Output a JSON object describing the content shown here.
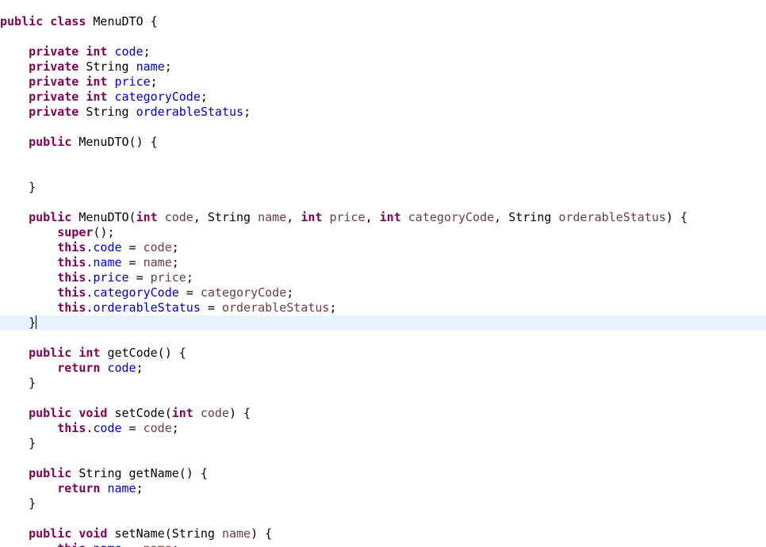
{
  "editor": {
    "current_line": 20,
    "colors": {
      "keyword": "#7f0055",
      "field": "#0000c0",
      "parameter": "#6a3e3e",
      "plain": "#000000",
      "current_line_highlight": "#e8f2fe"
    },
    "lines": [
      [
        {
          "t": "public",
          "c": "kw"
        },
        {
          "t": " "
        },
        {
          "t": "class",
          "c": "kw"
        },
        {
          "t": " MenuDTO {"
        }
      ],
      [],
      [
        {
          "t": "    "
        },
        {
          "t": "private",
          "c": "kw"
        },
        {
          "t": " "
        },
        {
          "t": "int",
          "c": "kw"
        },
        {
          "t": " "
        },
        {
          "t": "code",
          "c": "fld"
        },
        {
          "t": ";"
        }
      ],
      [
        {
          "t": "    "
        },
        {
          "t": "private",
          "c": "kw"
        },
        {
          "t": " String "
        },
        {
          "t": "name",
          "c": "fld"
        },
        {
          "t": ";"
        }
      ],
      [
        {
          "t": "    "
        },
        {
          "t": "private",
          "c": "kw"
        },
        {
          "t": " "
        },
        {
          "t": "int",
          "c": "kw"
        },
        {
          "t": " "
        },
        {
          "t": "price",
          "c": "fld"
        },
        {
          "t": ";"
        }
      ],
      [
        {
          "t": "    "
        },
        {
          "t": "private",
          "c": "kw"
        },
        {
          "t": " "
        },
        {
          "t": "int",
          "c": "kw"
        },
        {
          "t": " "
        },
        {
          "t": "categoryCode",
          "c": "fld"
        },
        {
          "t": ";"
        }
      ],
      [
        {
          "t": "    "
        },
        {
          "t": "private",
          "c": "kw"
        },
        {
          "t": " String "
        },
        {
          "t": "orderableStatus",
          "c": "fld"
        },
        {
          "t": ";"
        }
      ],
      [],
      [
        {
          "t": "    "
        },
        {
          "t": "public",
          "c": "kw"
        },
        {
          "t": " MenuDTO() {"
        }
      ],
      [],
      [],
      [
        {
          "t": "    }"
        }
      ],
      [],
      [
        {
          "t": "    "
        },
        {
          "t": "public",
          "c": "kw"
        },
        {
          "t": " MenuDTO("
        },
        {
          "t": "int",
          "c": "kw"
        },
        {
          "t": " "
        },
        {
          "t": "code",
          "c": "prm"
        },
        {
          "t": ", String "
        },
        {
          "t": "name",
          "c": "prm"
        },
        {
          "t": ", "
        },
        {
          "t": "int",
          "c": "kw"
        },
        {
          "t": " "
        },
        {
          "t": "price",
          "c": "prm"
        },
        {
          "t": ", "
        },
        {
          "t": "int",
          "c": "kw"
        },
        {
          "t": " "
        },
        {
          "t": "categoryCode",
          "c": "prm"
        },
        {
          "t": ", String "
        },
        {
          "t": "orderableStatus",
          "c": "prm"
        },
        {
          "t": ") {"
        }
      ],
      [
        {
          "t": "        "
        },
        {
          "t": "super",
          "c": "kw"
        },
        {
          "t": "();"
        }
      ],
      [
        {
          "t": "        "
        },
        {
          "t": "this",
          "c": "kw"
        },
        {
          "t": "."
        },
        {
          "t": "code",
          "c": "fld"
        },
        {
          "t": " = "
        },
        {
          "t": "code",
          "c": "prm"
        },
        {
          "t": ";"
        }
      ],
      [
        {
          "t": "        "
        },
        {
          "t": "this",
          "c": "kw"
        },
        {
          "t": "."
        },
        {
          "t": "name",
          "c": "fld"
        },
        {
          "t": " = "
        },
        {
          "t": "name",
          "c": "prm"
        },
        {
          "t": ";"
        }
      ],
      [
        {
          "t": "        "
        },
        {
          "t": "this",
          "c": "kw"
        },
        {
          "t": "."
        },
        {
          "t": "price",
          "c": "fld"
        },
        {
          "t": " = "
        },
        {
          "t": "price",
          "c": "prm"
        },
        {
          "t": ";"
        }
      ],
      [
        {
          "t": "        "
        },
        {
          "t": "this",
          "c": "kw"
        },
        {
          "t": "."
        },
        {
          "t": "categoryCode",
          "c": "fld"
        },
        {
          "t": " = "
        },
        {
          "t": "categoryCode",
          "c": "prm"
        },
        {
          "t": ";"
        }
      ],
      [
        {
          "t": "        "
        },
        {
          "t": "this",
          "c": "kw"
        },
        {
          "t": "."
        },
        {
          "t": "orderableStatus",
          "c": "fld"
        },
        {
          "t": " = "
        },
        {
          "t": "orderableStatus",
          "c": "prm"
        },
        {
          "t": ";"
        }
      ],
      [
        {
          "t": "    }"
        }
      ],
      [],
      [
        {
          "t": "    "
        },
        {
          "t": "public",
          "c": "kw"
        },
        {
          "t": " "
        },
        {
          "t": "int",
          "c": "kw"
        },
        {
          "t": " getCode() {"
        }
      ],
      [
        {
          "t": "        "
        },
        {
          "t": "return",
          "c": "kw"
        },
        {
          "t": " "
        },
        {
          "t": "code",
          "c": "fld"
        },
        {
          "t": ";"
        }
      ],
      [
        {
          "t": "    }"
        }
      ],
      [],
      [
        {
          "t": "    "
        },
        {
          "t": "public",
          "c": "kw"
        },
        {
          "t": " "
        },
        {
          "t": "void",
          "c": "kw"
        },
        {
          "t": " setCode("
        },
        {
          "t": "int",
          "c": "kw"
        },
        {
          "t": " "
        },
        {
          "t": "code",
          "c": "prm"
        },
        {
          "t": ") {"
        }
      ],
      [
        {
          "t": "        "
        },
        {
          "t": "this",
          "c": "kw"
        },
        {
          "t": "."
        },
        {
          "t": "code",
          "c": "fld"
        },
        {
          "t": " = "
        },
        {
          "t": "code",
          "c": "prm"
        },
        {
          "t": ";"
        }
      ],
      [
        {
          "t": "    }"
        }
      ],
      [],
      [
        {
          "t": "    "
        },
        {
          "t": "public",
          "c": "kw"
        },
        {
          "t": " String getName() {"
        }
      ],
      [
        {
          "t": "        "
        },
        {
          "t": "return",
          "c": "kw"
        },
        {
          "t": " "
        },
        {
          "t": "name",
          "c": "fld"
        },
        {
          "t": ";"
        }
      ],
      [
        {
          "t": "    }"
        }
      ],
      [],
      [
        {
          "t": "    "
        },
        {
          "t": "public",
          "c": "kw"
        },
        {
          "t": " "
        },
        {
          "t": "void",
          "c": "kw"
        },
        {
          "t": " setName(String "
        },
        {
          "t": "name",
          "c": "prm"
        },
        {
          "t": ") {"
        }
      ],
      [
        {
          "t": "        "
        },
        {
          "t": "this",
          "c": "kw"
        },
        {
          "t": "."
        },
        {
          "t": "name",
          "c": "fld"
        },
        {
          "t": " = "
        },
        {
          "t": "name",
          "c": "prm"
        },
        {
          "t": ";"
        }
      ]
    ]
  }
}
